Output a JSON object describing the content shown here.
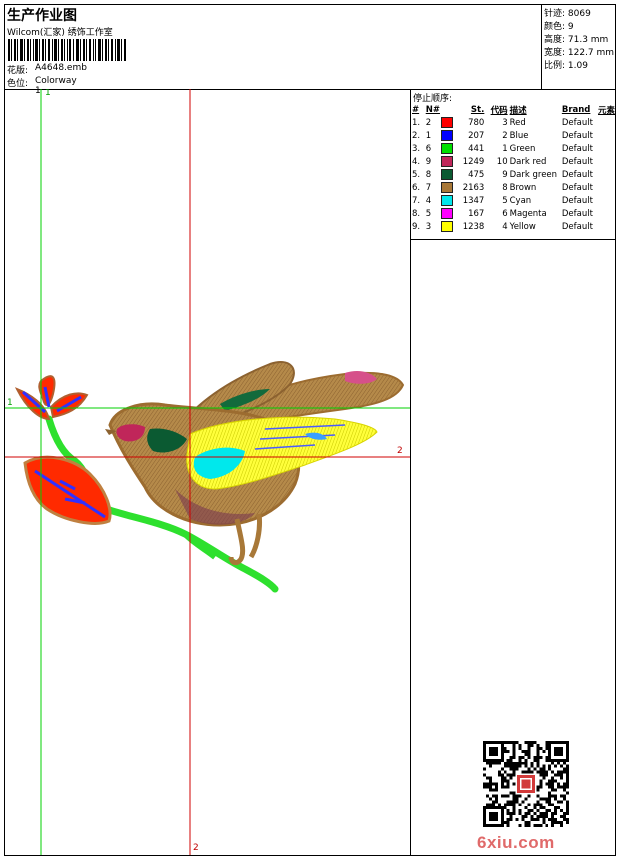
{
  "header": {
    "title": "生产作业图",
    "company": "Wilcom(汇家) 绣饰工作室",
    "design_label": "花版:",
    "design_file": "A4648.emb",
    "colorway_label": "色位:",
    "colorway": "Colorway 1"
  },
  "stats": {
    "stitches": "针迹: 8069",
    "colors": "颜色: 9",
    "height": "高度: 71.3 mm",
    "width": "宽度: 122.7 mm",
    "scale": "比例: 1.09"
  },
  "guides": {
    "green_top": "1",
    "green_left": "1",
    "red_right": "2",
    "red_bottom": "2"
  },
  "stop_sequence": {
    "title": "停止顺序:",
    "columns": [
      "#",
      "N#",
      "St.",
      "代码",
      "描述",
      "Brand",
      "元素"
    ],
    "rows": [
      {
        "idx": "1.",
        "n": "2",
        "color": "#ff0000",
        "st": "780",
        "code": "3",
        "desc": "Red",
        "brand": "Default"
      },
      {
        "idx": "2.",
        "n": "1",
        "color": "#0000ff",
        "st": "207",
        "code": "2",
        "desc": "Blue",
        "brand": "Default"
      },
      {
        "idx": "3.",
        "n": "6",
        "color": "#00e000",
        "st": "441",
        "code": "1",
        "desc": "Green",
        "brand": "Default"
      },
      {
        "idx": "4.",
        "n": "9",
        "color": "#c0265a",
        "st": "1249",
        "code": "10",
        "desc": "Dark red",
        "brand": "Default"
      },
      {
        "idx": "5.",
        "n": "8",
        "color": "#0b5a32",
        "st": "475",
        "code": "9",
        "desc": "Dark green",
        "brand": "Default"
      },
      {
        "idx": "6.",
        "n": "7",
        "color": "#a87838",
        "st": "2163",
        "code": "8",
        "desc": "Brown",
        "brand": "Default"
      },
      {
        "idx": "7.",
        "n": "4",
        "color": "#00e8ec",
        "st": "1347",
        "code": "5",
        "desc": "Cyan",
        "brand": "Default"
      },
      {
        "idx": "8.",
        "n": "5",
        "color": "#ff00ff",
        "st": "167",
        "code": "6",
        "desc": "Magenta",
        "brand": "Default"
      },
      {
        "idx": "9.",
        "n": "3",
        "color": "#ffff00",
        "st": "1238",
        "code": "4",
        "desc": "Yellow",
        "brand": "Default"
      }
    ]
  },
  "watermark": "6xiu.com"
}
